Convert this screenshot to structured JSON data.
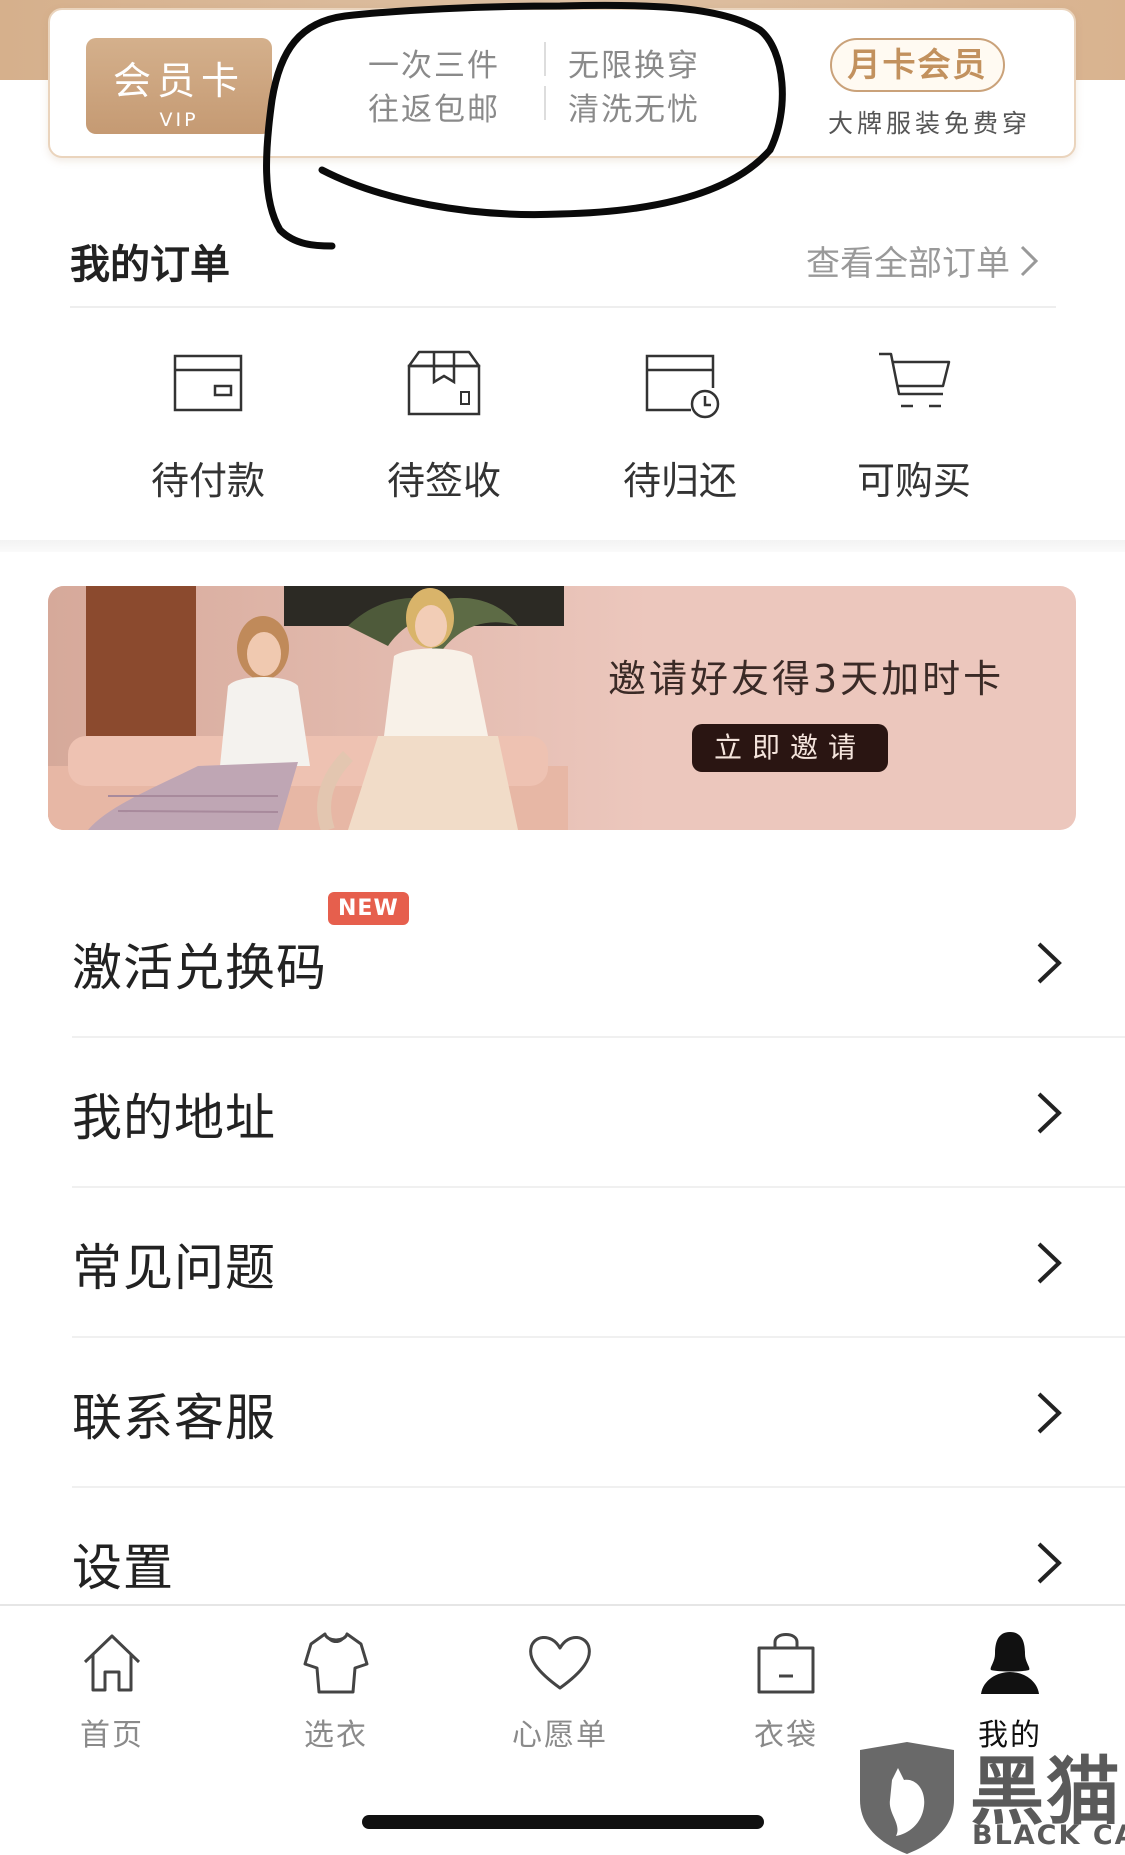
{
  "member": {
    "badge_title": "会员卡",
    "badge_sub": "VIP",
    "benefits": [
      "一次三件",
      "无限换穿",
      "往返包邮",
      "清洗无忧"
    ],
    "month_card": "月卡会员",
    "month_sub": "大牌服装免费穿"
  },
  "orders": {
    "title": "我的订单",
    "view_all": "查看全部订单",
    "items": [
      {
        "label": "待付款",
        "icon": "card-icon"
      },
      {
        "label": "待签收",
        "icon": "package-icon"
      },
      {
        "label": "待归还",
        "icon": "return-clock-icon"
      },
      {
        "label": "可购买",
        "icon": "cart-icon"
      }
    ]
  },
  "invite": {
    "text": "邀请好友得3天加时卡",
    "button": "立即邀请"
  },
  "menu": [
    {
      "label": "激活兑换码",
      "badge": "NEW"
    },
    {
      "label": "我的地址"
    },
    {
      "label": "常见问题"
    },
    {
      "label": "联系客服"
    },
    {
      "label": "设置"
    }
  ],
  "tabbar": [
    {
      "label": "首页",
      "icon": "home-icon",
      "active": false
    },
    {
      "label": "选衣",
      "icon": "shirt-icon",
      "active": false
    },
    {
      "label": "心愿单",
      "icon": "heart-icon",
      "active": false
    },
    {
      "label": "衣袋",
      "icon": "bag-icon",
      "active": false
    },
    {
      "label": "我的",
      "icon": "profile-icon",
      "active": true
    }
  ],
  "watermark": {
    "zh": "黑猫",
    "en": "BLACK CAT"
  },
  "colors": {
    "gold": "#c59a73",
    "badge_red": "#e65f4d",
    "invite_bg": "#ecc7bd",
    "invite_btn": "#2a1512"
  }
}
